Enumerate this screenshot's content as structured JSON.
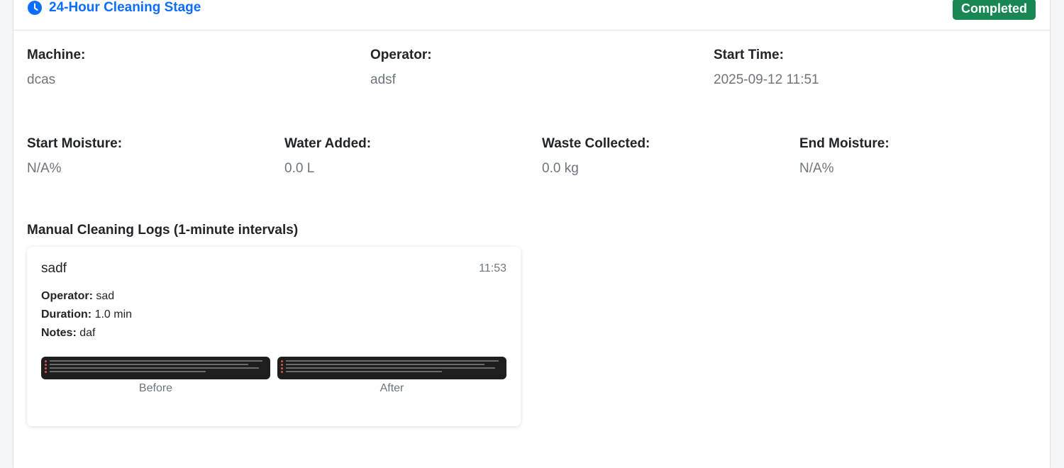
{
  "header": {
    "title": "24-Hour Cleaning Stage",
    "status": "Completed",
    "status_color": "#198754",
    "accent_color": "#0d6efd",
    "icon": "clock-icon"
  },
  "details": {
    "machine": {
      "label": "Machine:",
      "value": "dcas"
    },
    "operator": {
      "label": "Operator:",
      "value": "adsf"
    },
    "start_time": {
      "label": "Start Time:",
      "value": "2025-09-12 11:51"
    },
    "start_moisture": {
      "label": "Start Moisture:",
      "value": "N/A%"
    },
    "water_added": {
      "label": "Water Added:",
      "value": "0.0 L"
    },
    "waste_collected": {
      "label": "Waste Collected:",
      "value": "0.0 kg"
    },
    "end_moisture": {
      "label": "End Moisture:",
      "value": "N/A%"
    }
  },
  "logs": {
    "section_title": "Manual Cleaning Logs (1-minute intervals)",
    "items": [
      {
        "title": "sadf",
        "time": "11:53",
        "operator_label": "Operator:",
        "operator": "sad",
        "duration_label": "Duration:",
        "duration": "1.0 min",
        "notes_label": "Notes:",
        "notes": "daf",
        "before_caption": "Before",
        "after_caption": "After"
      }
    ]
  }
}
